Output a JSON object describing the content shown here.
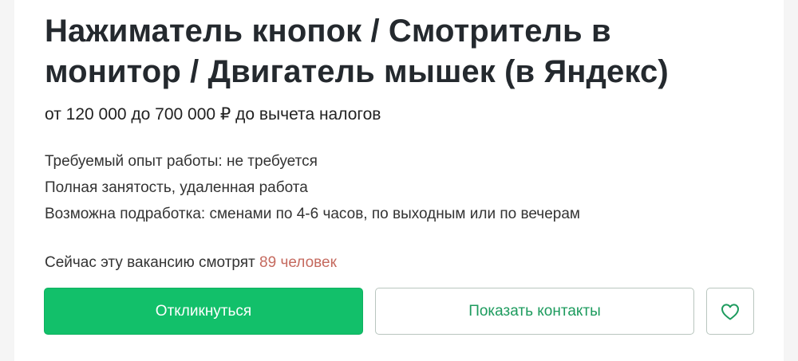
{
  "vacancy": {
    "title": "Нажиматель кнопок / Смотритель в монитор / Двигатель мышек (в Яндекс)",
    "salary": "от 120 000 до 700 000 ₽ до вычета налогов",
    "details": [
      "Требуемый опыт работы: не требуется",
      "Полная занятость, удаленная работа",
      "Возможна подработка: сменами по 4-6 часов, по выходным или по вечерам"
    ],
    "viewers_prefix": "Сейчас эту вакансию смотрят",
    "viewers_count": "89 человек"
  },
  "actions": {
    "apply_label": "Откликнуться",
    "contacts_label": "Показать контакты",
    "favorite_icon": "heart-icon"
  },
  "colors": {
    "apply_bg": "#12c06a",
    "contacts_text": "#1d9b5e",
    "viewers_count": "#c56a5f",
    "title_text": "#24292e"
  }
}
